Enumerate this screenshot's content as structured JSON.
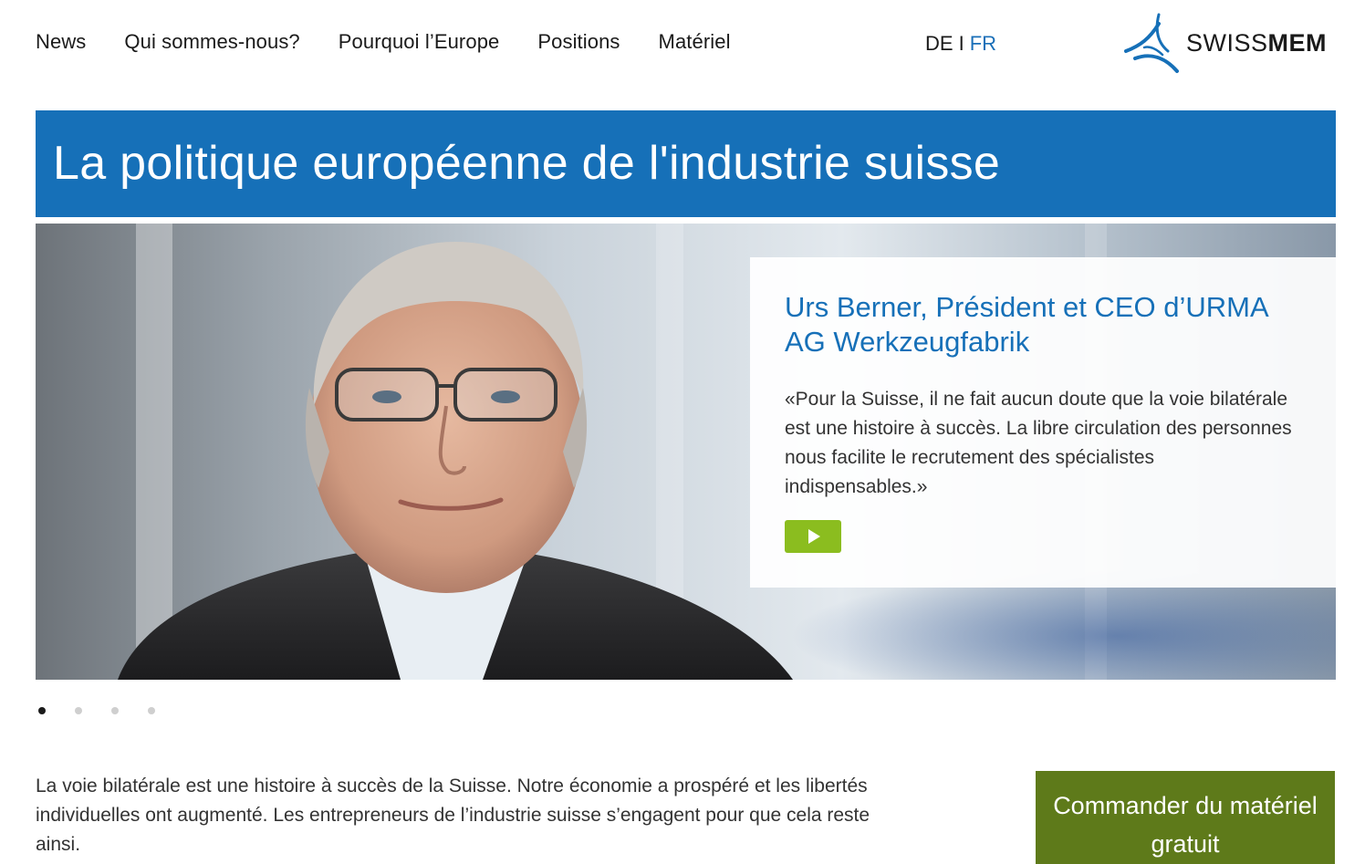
{
  "nav": {
    "items": [
      {
        "label": "News"
      },
      {
        "label": "Qui sommes-nous?"
      },
      {
        "label": "Pourquoi l’Europe"
      },
      {
        "label": "Positions"
      },
      {
        "label": "Matériel"
      }
    ]
  },
  "lang": {
    "de": "DE",
    "separator": "I",
    "fr": "FR",
    "active": "FR"
  },
  "logo": {
    "prefix": "SWISS",
    "suffix": "MEM",
    "icon": "swissmem-logo-icon"
  },
  "banner": {
    "title": "La politique européenne de l'industrie suisse"
  },
  "hero": {
    "quote_title": "Urs Berner, Président et CEO d’URMA AG Werkzeugfabrik",
    "quote_text": "«Pour la Suisse, il ne fait aucun doute que la voie bilatérale est une histoire à succès. La libre circulation des personnes nous facilite le recrutement des spécialistes indispensables.»",
    "play_icon": "play-icon"
  },
  "carousel": {
    "slides": 4,
    "active": 1
  },
  "intro": {
    "text": "La voie bilatérale est une histoire à succès de la Suisse. Notre économie a prospéré et les libertés individuelles ont augmenté. Les entrepreneurs de l’industrie suisse s’engagent pour que cela reste ainsi."
  },
  "cta": {
    "label": "Commander du matériel gratuit"
  },
  "colors": {
    "brand_blue": "#1670b8",
    "play_green": "#8bbd1f",
    "cta_green": "#5e7a1a"
  }
}
